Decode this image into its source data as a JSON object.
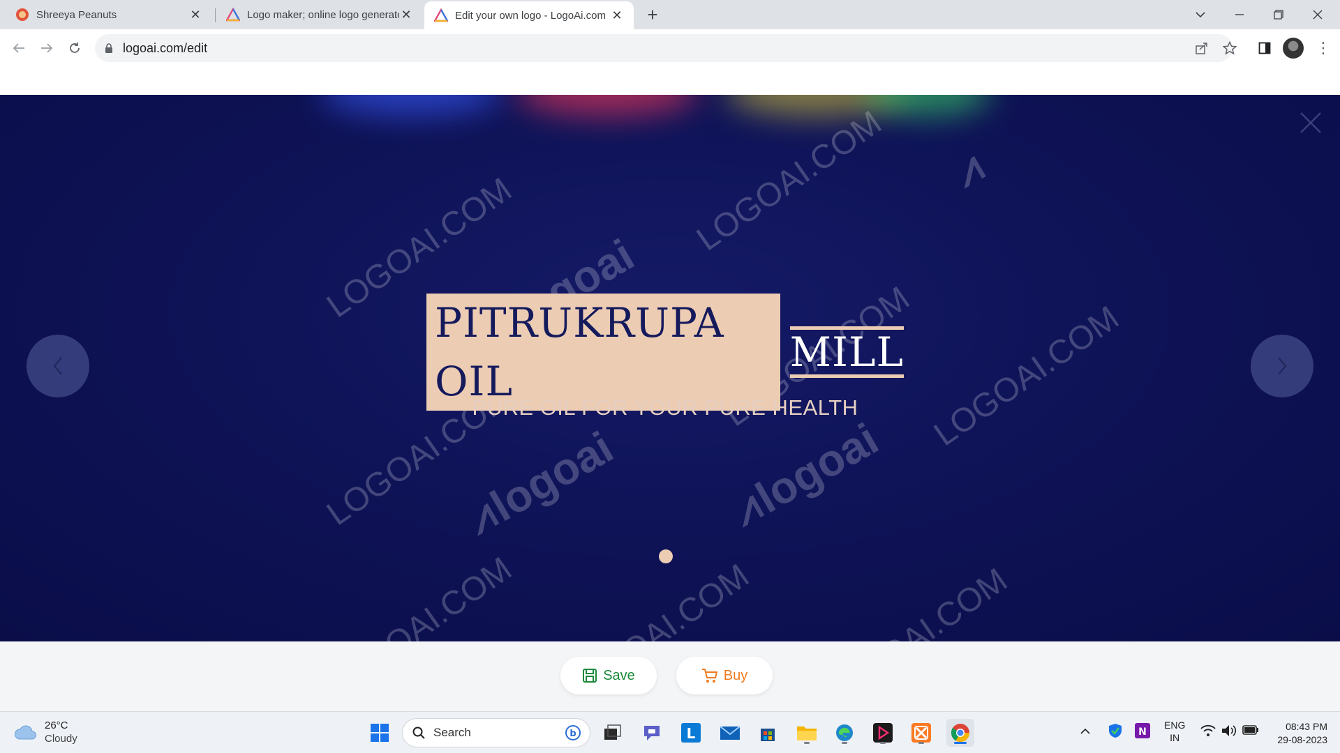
{
  "browser": {
    "tabs": [
      {
        "title": "Shreeya Peanuts",
        "favicon": "peanut-favicon"
      },
      {
        "title": "Logo maker; online logo generator",
        "favicon": "logoai-favicon"
      },
      {
        "title": "Edit your own logo - LogoAi.com",
        "favicon": "logoai-favicon",
        "active": true
      }
    ],
    "url": "logoai.com/edit"
  },
  "logo_preview": {
    "brand_part1": "PITRUKRUPA OIL",
    "brand_part2": "MILL",
    "slogan": "PURE OIL FOR YOUR PURE HEALTH",
    "watermark_text": "LOGOAI.COM",
    "watermark_logo": "logoai",
    "colors": {
      "background": "#0f1459",
      "accent": "#ecccb3",
      "text": "#ffffff"
    }
  },
  "actions": {
    "save_label": "Save",
    "buy_label": "Buy"
  },
  "taskbar": {
    "weather_temp": "26°C",
    "weather_condition": "Cloudy",
    "search_placeholder": "Search",
    "language": "ENG",
    "region": "IN",
    "time": "08:43 PM",
    "date": "29-08-2023"
  }
}
